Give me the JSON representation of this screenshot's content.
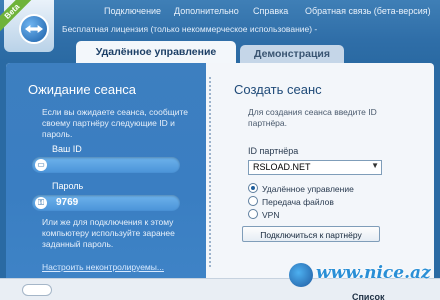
{
  "header": {
    "beta_ribbon": "Beta",
    "menu": {
      "connection": "Подключение",
      "extras": "Дополнительно",
      "help": "Справка",
      "feedback": "Обратная связь (бета-версия)"
    },
    "license_text": "Бесплатная лицензия (только некоммерческое использование) -"
  },
  "tabs": {
    "remote_control": "Удалённое управление",
    "meeting": "Демонстрация"
  },
  "left": {
    "title": "Ожидание сеанса",
    "description": "Если вы ожидаете сеанса, сообщите своему партнёру следующие ID и пароль.",
    "id_label": "Ваш ID",
    "id_value": "",
    "password_label": "Пароль",
    "password_value": "9769",
    "description2": "Или же для подключения к этому компьютеру используйте заранее заданный пароль.",
    "link": "Настроить неконтролируемы..."
  },
  "right": {
    "title": "Создать сеанс",
    "description": "Для создания сеанса введите ID партнёра.",
    "partner_id_label": "ID партнёра",
    "partner_id_value": "RSLOAD.NET",
    "options": [
      {
        "label": "Удалённое управление",
        "selected": true
      },
      {
        "label": "Передача файлов",
        "selected": false
      },
      {
        "label": "VPN",
        "selected": false
      }
    ],
    "connect_button": "Подключиться к партнёру"
  },
  "bottom": {
    "list_label": "Список"
  },
  "watermark": {
    "text": "www.nice.az"
  },
  "colors": {
    "header_blue": "#2f6ea8",
    "panel_blue": "#3a7ec2",
    "beta_green": "#6fb33a"
  }
}
